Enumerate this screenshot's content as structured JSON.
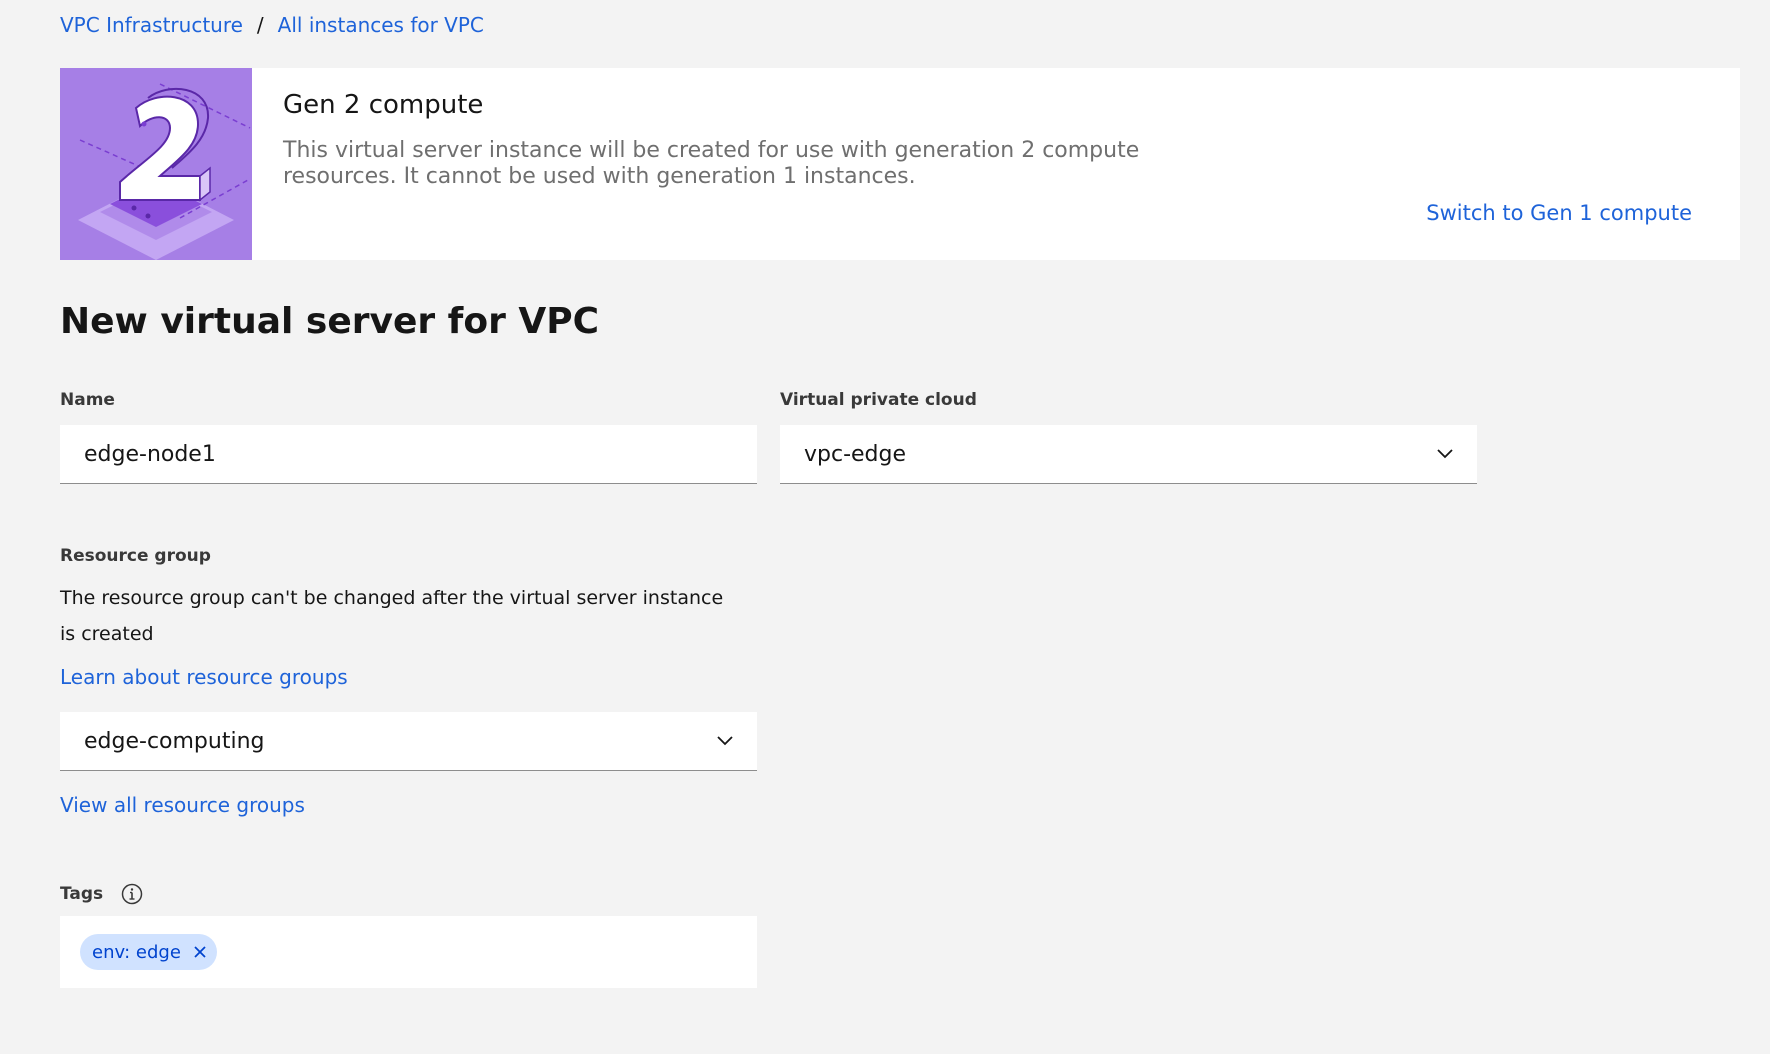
{
  "breadcrumb": {
    "items": [
      "VPC Infrastructure",
      "All instances for VPC"
    ],
    "separator": "/"
  },
  "banner": {
    "title": "Gen 2 compute",
    "description": "This virtual server instance will be created for use with generation 2 compute resources. It cannot be used with generation 1 instances.",
    "switch_link": "Switch to Gen 1 compute",
    "art_icon": "gen-2-illustration",
    "art_color": "#a67fe6"
  },
  "page_title": "New virtual server for VPC",
  "form": {
    "name": {
      "label": "Name",
      "value": "edge-node1"
    },
    "vpc": {
      "label": "Virtual private cloud",
      "value": "vpc-edge"
    },
    "resource_group": {
      "label": "Resource group",
      "helper": "The resource group can't be changed after the virtual server instance is created",
      "learn_link": "Learn about resource groups",
      "value": "edge-computing",
      "view_all_link": "View all resource groups"
    },
    "tags": {
      "label": "Tags",
      "items": [
        "env: edge"
      ]
    }
  },
  "colors": {
    "background": "#f3f3f3",
    "link": "#1e63d9",
    "tag_bg": "#d0e2ff",
    "tag_text": "#0043ce"
  }
}
